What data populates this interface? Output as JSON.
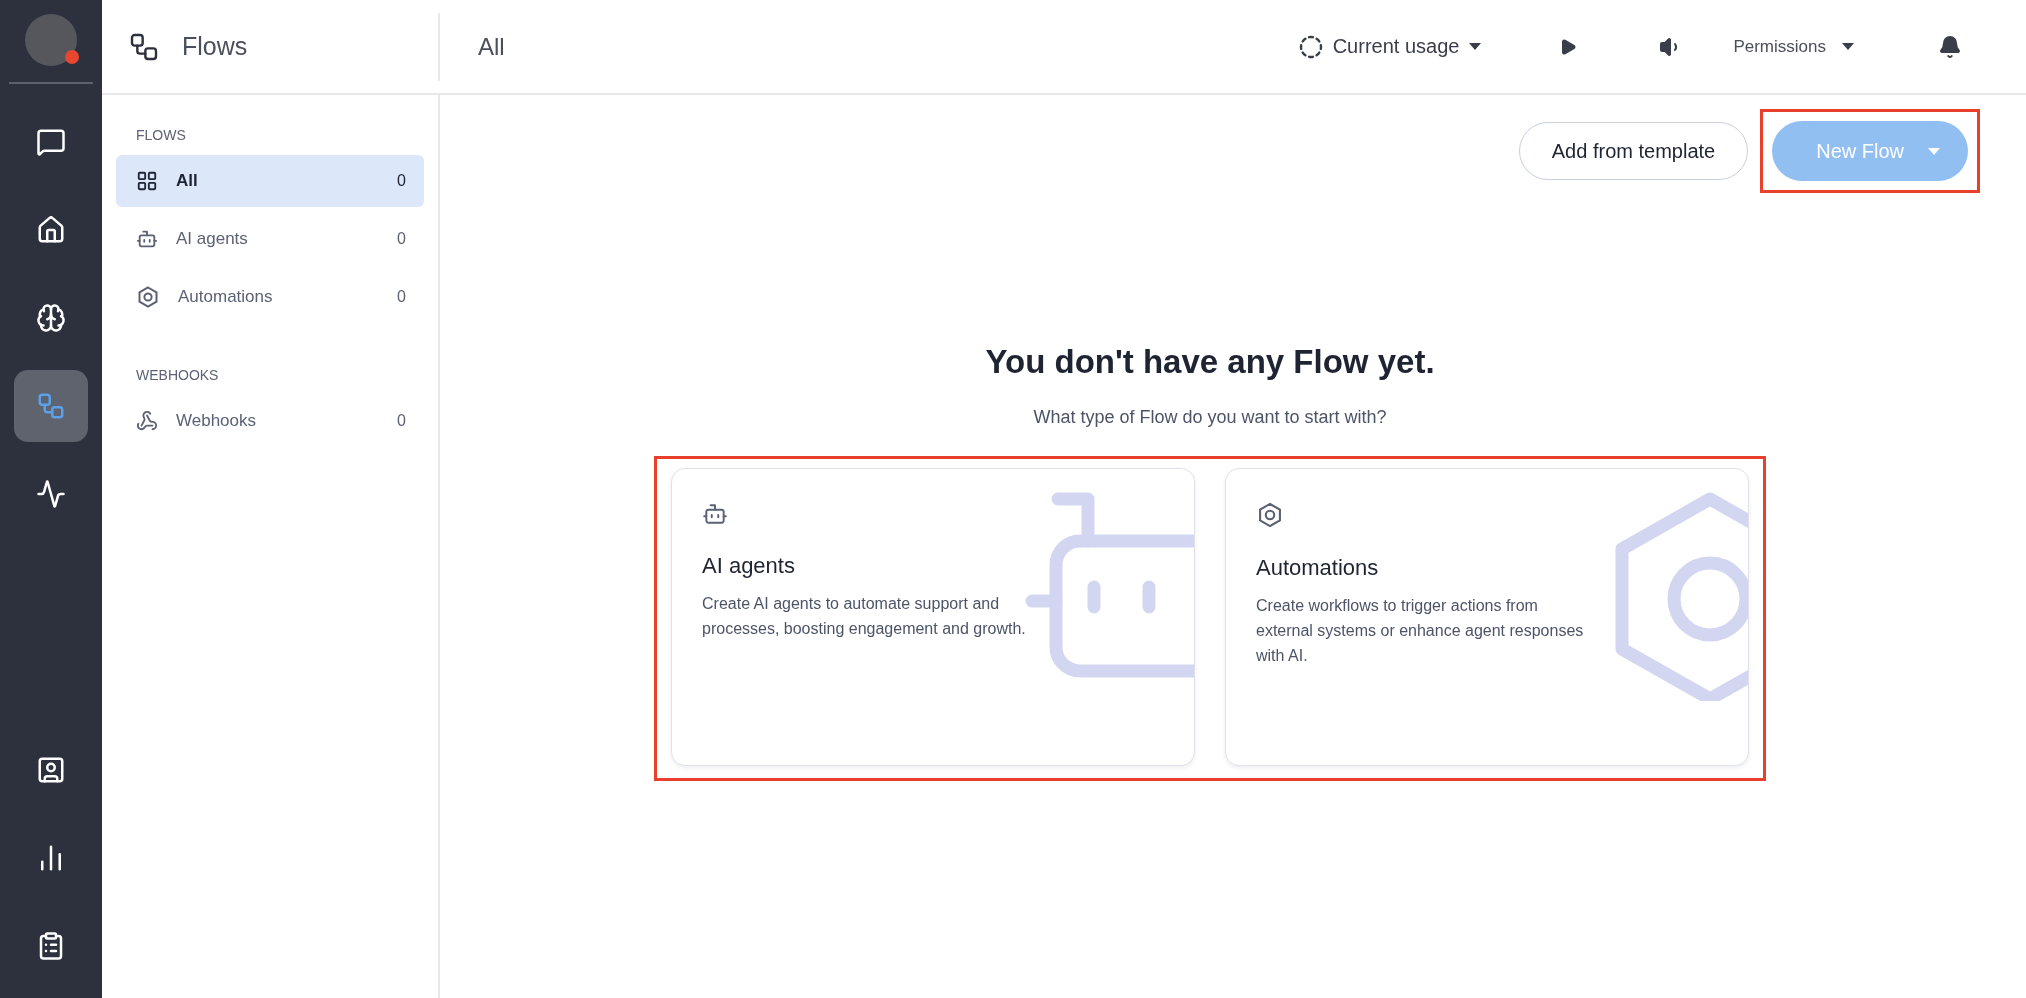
{
  "rail": {
    "items": [
      {
        "kind": "chat",
        "selected": false
      },
      {
        "kind": "home",
        "selected": false
      },
      {
        "kind": "brain",
        "selected": false
      },
      {
        "kind": "flows",
        "selected": true
      },
      {
        "kind": "activity",
        "selected": false
      }
    ],
    "bottom_items": [
      {
        "kind": "contacts",
        "selected": false
      },
      {
        "kind": "reports",
        "selected": false
      },
      {
        "kind": "tasks",
        "selected": false
      }
    ]
  },
  "header": {
    "title": "Flows",
    "page_title": "All",
    "usage": "Current usage",
    "permissions": "Permissions"
  },
  "sidebar": {
    "sections": [
      {
        "heading": "FLOWS",
        "items": [
          {
            "kind": "all",
            "label": "All",
            "count": "0",
            "selected": true
          },
          {
            "kind": "agent",
            "label": "AI agents",
            "count": "0",
            "selected": false
          },
          {
            "kind": "automation",
            "label": "Automations",
            "count": "0",
            "selected": false
          }
        ]
      },
      {
        "heading": "WEBHOOKS",
        "items": [
          {
            "kind": "webhook",
            "label": "Webhooks",
            "count": "0",
            "selected": false
          }
        ]
      }
    ]
  },
  "actions": {
    "secondary": "Add from template",
    "primary": {
      "label": "New Flow",
      "highlighted": true
    }
  },
  "empty_state": {
    "title": "You don't have any Flow yet.",
    "subtitle": "What type of Flow do you want to start with?",
    "highlighted": true,
    "cards": [
      {
        "kind": "agent",
        "title": "AI agents",
        "text": "Create AI agents to automate support and processes, boosting engagement and growth."
      },
      {
        "kind": "automation",
        "title": "Automations",
        "text": "Create workflows to trigger actions from external systems or enhance agent responses with AI."
      }
    ]
  }
}
